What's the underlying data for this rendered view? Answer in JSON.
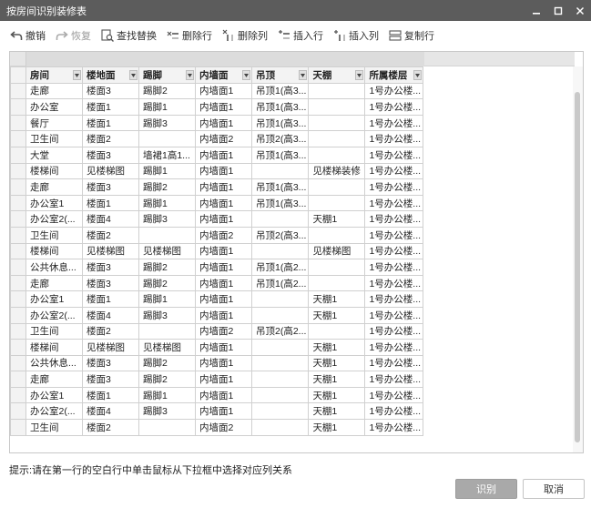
{
  "window": {
    "title": "按房间识别装修表"
  },
  "toolbar": {
    "items": [
      {
        "label": "撤销",
        "icon": "undo-icon",
        "disabled": false
      },
      {
        "label": "恢复",
        "icon": "redo-icon",
        "disabled": true
      },
      {
        "label": "查找替换",
        "icon": "find-replace-icon",
        "disabled": false
      },
      {
        "label": "删除行",
        "icon": "delete-row-icon",
        "disabled": false
      },
      {
        "label": "删除列",
        "icon": "delete-column-icon",
        "disabled": false
      },
      {
        "label": "插入行",
        "icon": "insert-row-icon",
        "disabled": false
      },
      {
        "label": "插入列",
        "icon": "insert-column-icon",
        "disabled": false
      },
      {
        "label": "复制行",
        "icon": "copy-row-icon",
        "disabled": false
      }
    ]
  },
  "table": {
    "headers": [
      "房间",
      "楼地面",
      "踢脚",
      "内墙面",
      "吊顶",
      "天棚",
      "所属楼层"
    ],
    "rows": [
      [
        "走廊",
        "楼面3",
        "踢脚2",
        "内墙面1",
        "吊顶1(高3...",
        "",
        "1号办公楼..."
      ],
      [
        "办公室",
        "楼面1",
        "踢脚1",
        "内墙面1",
        "吊顶1(高3...",
        "",
        "1号办公楼..."
      ],
      [
        "餐厅",
        "楼面1",
        "踢脚3",
        "内墙面1",
        "吊顶1(高3...",
        "",
        "1号办公楼..."
      ],
      [
        "卫生间",
        "楼面2",
        "",
        "内墙面2",
        "吊顶2(高3...",
        "",
        "1号办公楼..."
      ],
      [
        "大堂",
        "楼面3",
        "墙裙1高1...",
        "内墙面1",
        "吊顶1(高3...",
        "",
        "1号办公楼..."
      ],
      [
        "楼梯间",
        "见楼梯图",
        "踢脚1",
        "内墙面1",
        "",
        "见楼梯装修",
        "1号办公楼..."
      ],
      [
        "走廊",
        "楼面3",
        "踢脚2",
        "内墙面1",
        "吊顶1(高3...",
        "",
        "1号办公楼..."
      ],
      [
        "办公室1",
        "楼面1",
        "踢脚1",
        "内墙面1",
        "吊顶1(高3...",
        "",
        "1号办公楼..."
      ],
      [
        "办公室2(...",
        "楼面4",
        "踢脚3",
        "内墙面1",
        "",
        "天棚1",
        "1号办公楼..."
      ],
      [
        "卫生间",
        "楼面2",
        "",
        "内墙面2",
        "吊顶2(高3...",
        "",
        "1号办公楼..."
      ],
      [
        "楼梯间",
        "见楼梯图",
        "见楼梯图",
        "内墙面1",
        "",
        "见楼梯图",
        "1号办公楼..."
      ],
      [
        "公共休息...",
        "楼面3",
        "踢脚2",
        "内墙面1",
        "吊顶1(高2...",
        "",
        "1号办公楼..."
      ],
      [
        "走廊",
        "楼面3",
        "踢脚2",
        "内墙面1",
        "吊顶1(高2...",
        "",
        "1号办公楼..."
      ],
      [
        "办公室1",
        "楼面1",
        "踢脚1",
        "内墙面1",
        "",
        "天棚1",
        "1号办公楼..."
      ],
      [
        "办公室2(...",
        "楼面4",
        "踢脚3",
        "内墙面1",
        "",
        "天棚1",
        "1号办公楼..."
      ],
      [
        "卫生间",
        "楼面2",
        "",
        "内墙面2",
        "吊顶2(高2...",
        "",
        "1号办公楼..."
      ],
      [
        "楼梯间",
        "见楼梯图",
        "见楼梯图",
        "内墙面1",
        "",
        "天棚1",
        "1号办公楼..."
      ],
      [
        "公共休息...",
        "楼面3",
        "踢脚2",
        "内墙面1",
        "",
        "天棚1",
        "1号办公楼..."
      ],
      [
        "走廊",
        "楼面3",
        "踢脚2",
        "内墙面1",
        "",
        "天棚1",
        "1号办公楼..."
      ],
      [
        "办公室1",
        "楼面1",
        "踢脚1",
        "内墙面1",
        "",
        "天棚1",
        "1号办公楼..."
      ],
      [
        "办公室2(...",
        "楼面4",
        "踢脚3",
        "内墙面1",
        "",
        "天棚1",
        "1号办公楼..."
      ],
      [
        "卫生间",
        "楼面2",
        "",
        "内墙面2",
        "",
        "天棚1",
        "1号办公楼..."
      ]
    ]
  },
  "hint": "提示:请在第一行的空白行中单击鼠标从下拉框中选择对应列关系",
  "buttons": {
    "recognize": "识别",
    "cancel": "取消"
  }
}
